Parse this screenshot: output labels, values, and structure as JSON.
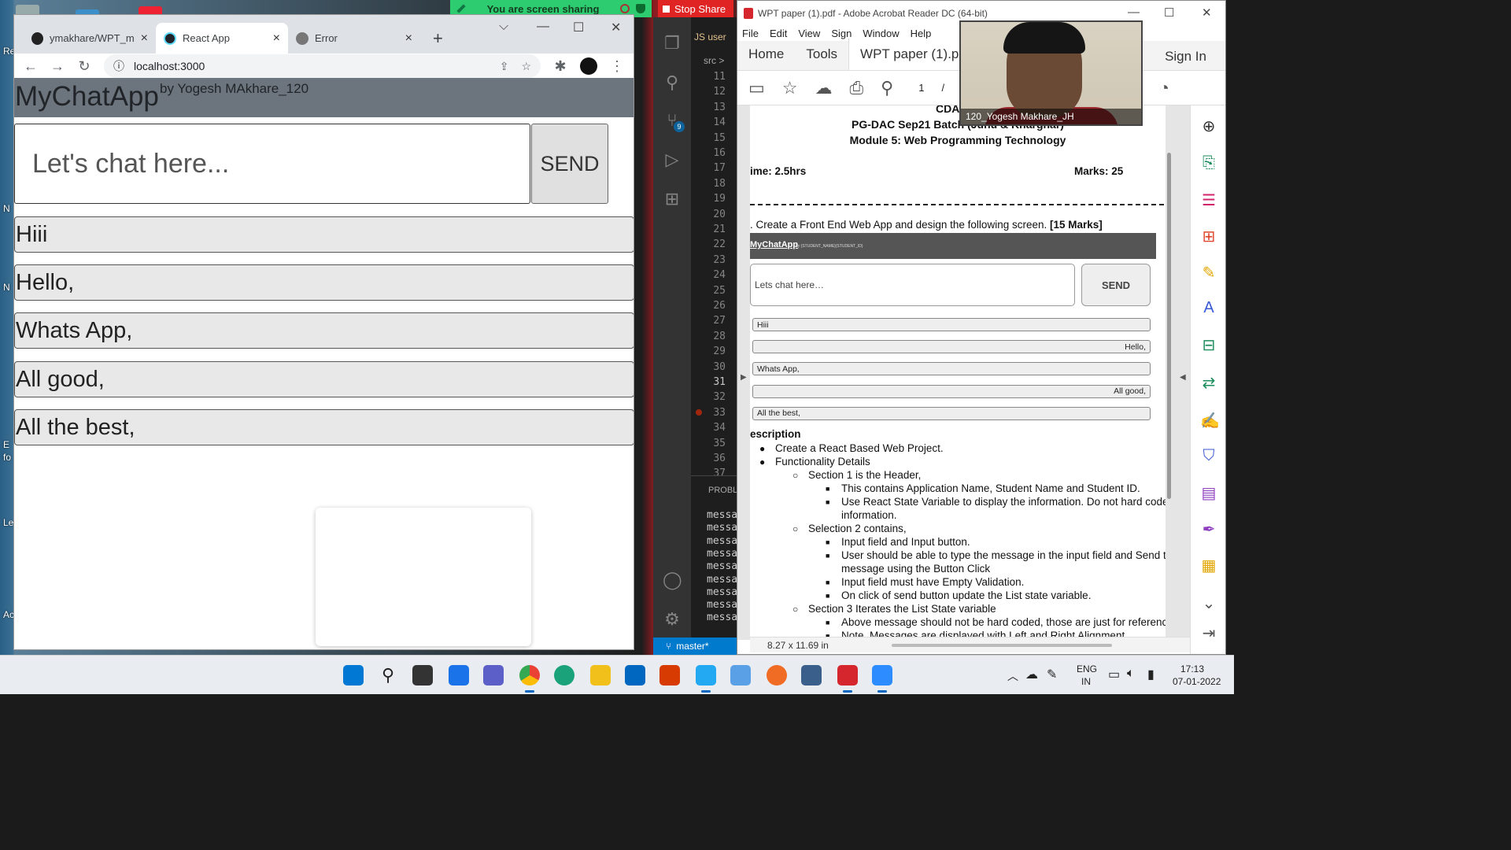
{
  "screen_share": {
    "status": "You are screen sharing",
    "stop_label": "Stop Share"
  },
  "desktop": {
    "labels": [
      "Re",
      "N",
      "N",
      "E",
      "fo",
      "Le",
      "Ac"
    ]
  },
  "browser": {
    "tabs": [
      {
        "label": "ymakhare/WPT_m",
        "icon": "github-icon"
      },
      {
        "label": "React App",
        "icon": "react-icon"
      },
      {
        "label": "Error",
        "icon": "globe-icon"
      }
    ],
    "url": "localhost:3000"
  },
  "chat_app": {
    "title": "MyChatApp",
    "subtitle": "by Yogesh MAkhare_120",
    "input_placeholder": "Let's chat here...",
    "send_label": "SEND",
    "messages": [
      "Hiii",
      "Hello,",
      "Whats App,",
      "All good,",
      "All the best,"
    ]
  },
  "vscode": {
    "tab_label": "JS user",
    "breadcrumb": "src >",
    "line_numbers": [
      "11",
      "12",
      "13",
      "14",
      "15",
      "16",
      "17",
      "18",
      "19",
      "20",
      "21",
      "22",
      "23",
      "24",
      "25",
      "26",
      "27",
      "28",
      "29",
      "30",
      "31",
      "32",
      "33",
      "34",
      "35",
      "36",
      "37"
    ],
    "current_line": "31",
    "source_control_badge": "9",
    "panel_label": "PROBL",
    "terminal_lines": [
      "messa",
      "messa",
      "messa",
      "messa",
      "messa",
      "messa",
      "messa",
      "messa",
      "messa"
    ],
    "branch": "master*"
  },
  "acrobat": {
    "window_title": "WPT paper (1).pdf - Adobe Acrobat Reader DC (64-bit)",
    "menu": [
      "File",
      "Edit",
      "View",
      "Sign",
      "Window",
      "Help"
    ],
    "tabs": {
      "home": "Home",
      "tools": "Tools",
      "doc": "WPT paper (1).p"
    },
    "sign_in": "Sign In",
    "page_number": "1",
    "page_sep": "/",
    "page_size": "8.27 x 11.69 in",
    "page": {
      "header1": "CDAC M",
      "header2": "PG-DAC Sep21 Batch (Juhu & Kharghar)",
      "header3": "Module 5: Web Programming Technology",
      "time": "ime: 2.5hrs",
      "marks": "Marks: 25",
      "question": ". Create a Front End Web App and design the following screen.",
      "question_marks": "[15 Marks]",
      "mini_title": "MyChatApp",
      "mini_subtitle": "by {STUDENT_NAME}{STUDENT_ID}",
      "mini_input": "Lets chat here…",
      "mini_send": "SEND",
      "mini_messages": [
        {
          "text": "Hiii",
          "align": "left"
        },
        {
          "text": "Hello,",
          "align": "right"
        },
        {
          "text": "Whats App,",
          "align": "left"
        },
        {
          "text": "All good,",
          "align": "right"
        },
        {
          "text": "All the best,",
          "align": "left"
        }
      ],
      "desc_heading": "escription",
      "desc_lines": [
        {
          "level": 1,
          "bullet": "●",
          "text": "Create a React Based Web Project."
        },
        {
          "level": 1,
          "bullet": "●",
          "text": "Functionality Details"
        },
        {
          "level": 2,
          "bullet": "○",
          "text": "Section 1 is the Header,"
        },
        {
          "level": 3,
          "bullet": "■",
          "text": "This contains Application Name, Student Name and Student ID."
        },
        {
          "level": 3,
          "bullet": "■",
          "text": "Use React State Variable to display the information. Do not hard code th"
        },
        {
          "level": 4,
          "bullet": "",
          "text": "information."
        },
        {
          "level": 2,
          "bullet": "○",
          "text": "Selection 2 contains,"
        },
        {
          "level": 3,
          "bullet": "■",
          "text": "Input field and Input button."
        },
        {
          "level": 3,
          "bullet": "■",
          "text": "User should be able to type the message in the input field and Send the"
        },
        {
          "level": 4,
          "bullet": "",
          "text": "message using the Button Click"
        },
        {
          "level": 3,
          "bullet": "■",
          "text": "Input field must have Empty Validation."
        },
        {
          "level": 3,
          "bullet": "■",
          "text": "On click of send button update the List state variable."
        },
        {
          "level": 2,
          "bullet": "○",
          "text": "Section 3 Iterates the List State variable"
        },
        {
          "level": 3,
          "bullet": "■",
          "text": "Above message should not be hard coded, those are just for reference."
        },
        {
          "level": 3,
          "bullet": "■",
          "text": "Note, Messages are displayed with Left and Right Alignment"
        }
      ]
    }
  },
  "webcam": {
    "name": "120_Yogesh Makhare_JH"
  },
  "taskbar": {
    "language": "ENG",
    "region": "IN",
    "time": "17:13",
    "date": "07-01-2022"
  },
  "colors": {
    "app_header": "#6c757d",
    "share_green": "#2ecc71",
    "stop_red": "#e02424",
    "vscode_status": "#007acc"
  }
}
